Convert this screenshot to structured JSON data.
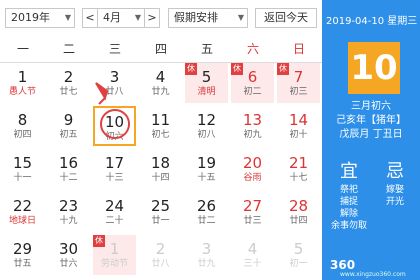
{
  "toolbar": {
    "year": "2019年",
    "month_prev": "<",
    "month": "4月",
    "month_next": ">",
    "holiday": "假期安排",
    "today": "返回今天"
  },
  "week": [
    "一",
    "二",
    "三",
    "四",
    "五",
    "六",
    "日"
  ],
  "rows": [
    [
      {
        "d": "1",
        "l": "愚人节",
        "f": true
      },
      {
        "d": "2",
        "l": "廿七"
      },
      {
        "d": "3",
        "l": "廿八"
      },
      {
        "d": "4",
        "l": "廿九"
      },
      {
        "d": "5",
        "l": "清明",
        "f": true,
        "rest": true,
        "badge": "休"
      },
      {
        "d": "6",
        "l": "初二",
        "rest": true,
        "badge": "休",
        "w": true
      },
      {
        "d": "7",
        "l": "初三",
        "rest": true,
        "badge": "休",
        "w": true
      }
    ],
    [
      {
        "d": "8",
        "l": "初四"
      },
      {
        "d": "9",
        "l": "初五"
      },
      {
        "d": "10",
        "l": "初六",
        "sel": true
      },
      {
        "d": "11",
        "l": "初七"
      },
      {
        "d": "12",
        "l": "初八"
      },
      {
        "d": "13",
        "l": "初九",
        "w": true
      },
      {
        "d": "14",
        "l": "初十",
        "w": true
      }
    ],
    [
      {
        "d": "15",
        "l": "十一"
      },
      {
        "d": "16",
        "l": "十二"
      },
      {
        "d": "17",
        "l": "十三"
      },
      {
        "d": "18",
        "l": "十四"
      },
      {
        "d": "19",
        "l": "十五"
      },
      {
        "d": "20",
        "l": "谷雨",
        "f": true,
        "w": true
      },
      {
        "d": "21",
        "l": "十七",
        "w": true
      }
    ],
    [
      {
        "d": "22",
        "l": "地球日",
        "f": true
      },
      {
        "d": "23",
        "l": "十九"
      },
      {
        "d": "24",
        "l": "二十"
      },
      {
        "d": "25",
        "l": "廿一"
      },
      {
        "d": "26",
        "l": "廿二"
      },
      {
        "d": "27",
        "l": "廿三",
        "w": true
      },
      {
        "d": "28",
        "l": "廿四",
        "w": true
      }
    ],
    [
      {
        "d": "29",
        "l": "廿五"
      },
      {
        "d": "30",
        "l": "廿六"
      },
      {
        "d": "1",
        "l": "劳动节",
        "other": true,
        "rest": true,
        "badge": "休"
      },
      {
        "d": "2",
        "l": "廿八",
        "other": true
      },
      {
        "d": "3",
        "l": "廿九",
        "other": true
      },
      {
        "d": "4",
        "l": "三十",
        "other": true
      },
      {
        "d": "5",
        "l": "初一",
        "other": true
      }
    ]
  ],
  "side": {
    "date": "2019-04-10 星期三",
    "big": "10",
    "lunar": "三月初六",
    "ganzhi_year": "己亥年【猪年】",
    "ganzhi_day": "戊辰月 丁丑日",
    "yi": "宜",
    "ji": "忌",
    "yi_items": [
      "祭祀",
      "捕捉",
      "解除",
      "余事勿取"
    ],
    "ji_items": [
      "嫁娶",
      "开光"
    ]
  },
  "watermark": "360",
  "watermark_sub": "www.xingzuo360.com",
  "colors": {
    "accent": "#2d8fe8",
    "highlight": "#f5a623",
    "holiday": "#e04040"
  }
}
